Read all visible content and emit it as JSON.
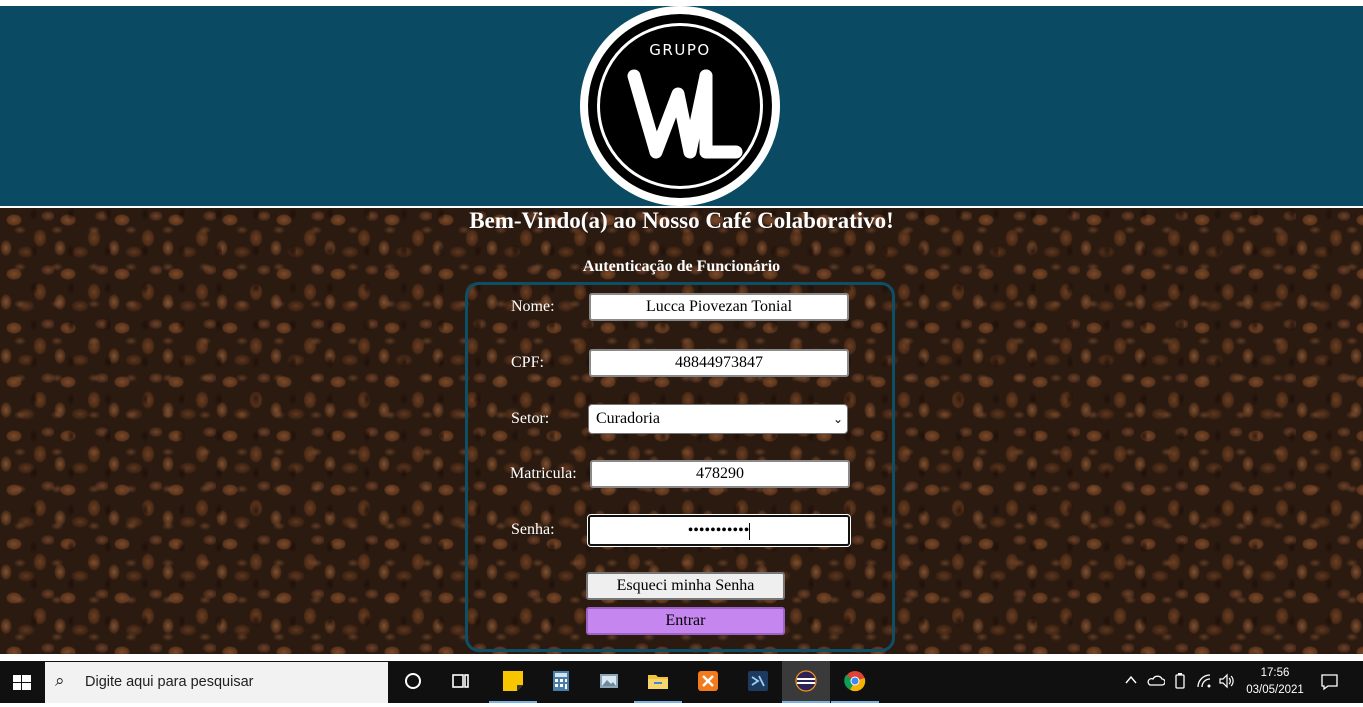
{
  "header": {
    "logo_top_text": "GRUPO",
    "logo_letters": "WL",
    "background_color": "#0a4a62"
  },
  "main": {
    "welcome": "Bem-Vindo(a) ao Nosso Café Colaborativo!",
    "subtitle": "Autenticação de Funcionário",
    "form": {
      "nome_label": "Nome:",
      "nome_value": "Lucca Piovezan Tonial",
      "cpf_label": "CPF:",
      "cpf_value": "48844973847",
      "setor_label": "Setor:",
      "setor_value": "Curadoria",
      "matricula_label": "Matricula:",
      "matricula_value": "478290",
      "senha_label": "Senha:",
      "senha_value": "•••••••••••",
      "forgot_button": "Esqueci minha Senha",
      "enter_button": "Entrar",
      "enter_color": "#c586ef"
    }
  },
  "taskbar": {
    "search_placeholder": "Digite aqui para pesquisar",
    "time": "17:56",
    "date": "03/05/2021",
    "apps": [
      "cortana-icon",
      "task-view-icon",
      "sticky-notes-icon",
      "calculator-icon",
      "photos-icon",
      "file-explorer-icon",
      "xampp-icon",
      "vscode-icon",
      "eclipse-icon",
      "chrome-icon"
    ]
  }
}
